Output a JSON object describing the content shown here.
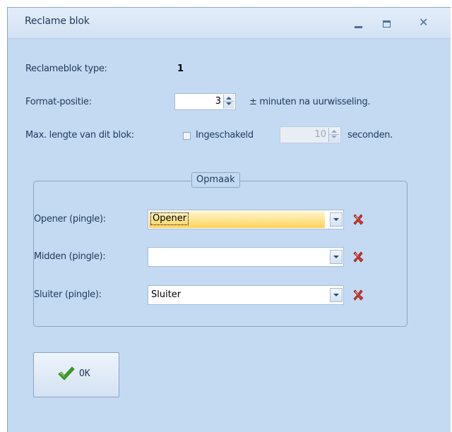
{
  "window": {
    "title": "Reclame blok"
  },
  "fields": {
    "type_label": "Reclameblok type:",
    "type_value": "1",
    "format_label": "Format-positie:",
    "format_value": "3",
    "format_suffix": "± minuten na uurwisseling.",
    "maxlen_label": "Max. lengte van dit blok:",
    "maxlen_checkbox_label": "Ingeschakeld",
    "maxlen_checked": false,
    "maxlen_value": "10",
    "maxlen_suffix": "seconden."
  },
  "layout_group": {
    "legend": "Opmaak",
    "rows": [
      {
        "label": "Opener (pingle):",
        "value": "Opener",
        "focused": true
      },
      {
        "label": "Midden (pingle):",
        "value": ""
      },
      {
        "label": "Sluiter (pingle):",
        "value": "Sluiter"
      }
    ]
  },
  "ok_button": {
    "label": "OK"
  },
  "icons": {
    "minimize": "minimize-icon",
    "maximize": "maximize-icon",
    "close": "close-icon",
    "clear": "clear-x-icon",
    "ok": "checkmark-icon",
    "dropdown": "chevron-down-icon"
  },
  "colors": {
    "window_bg": "#c4daf3",
    "focus_highlight": "#ffd35c",
    "clear_icon": "#c8281e",
    "ok_check": "#3ca021"
  }
}
